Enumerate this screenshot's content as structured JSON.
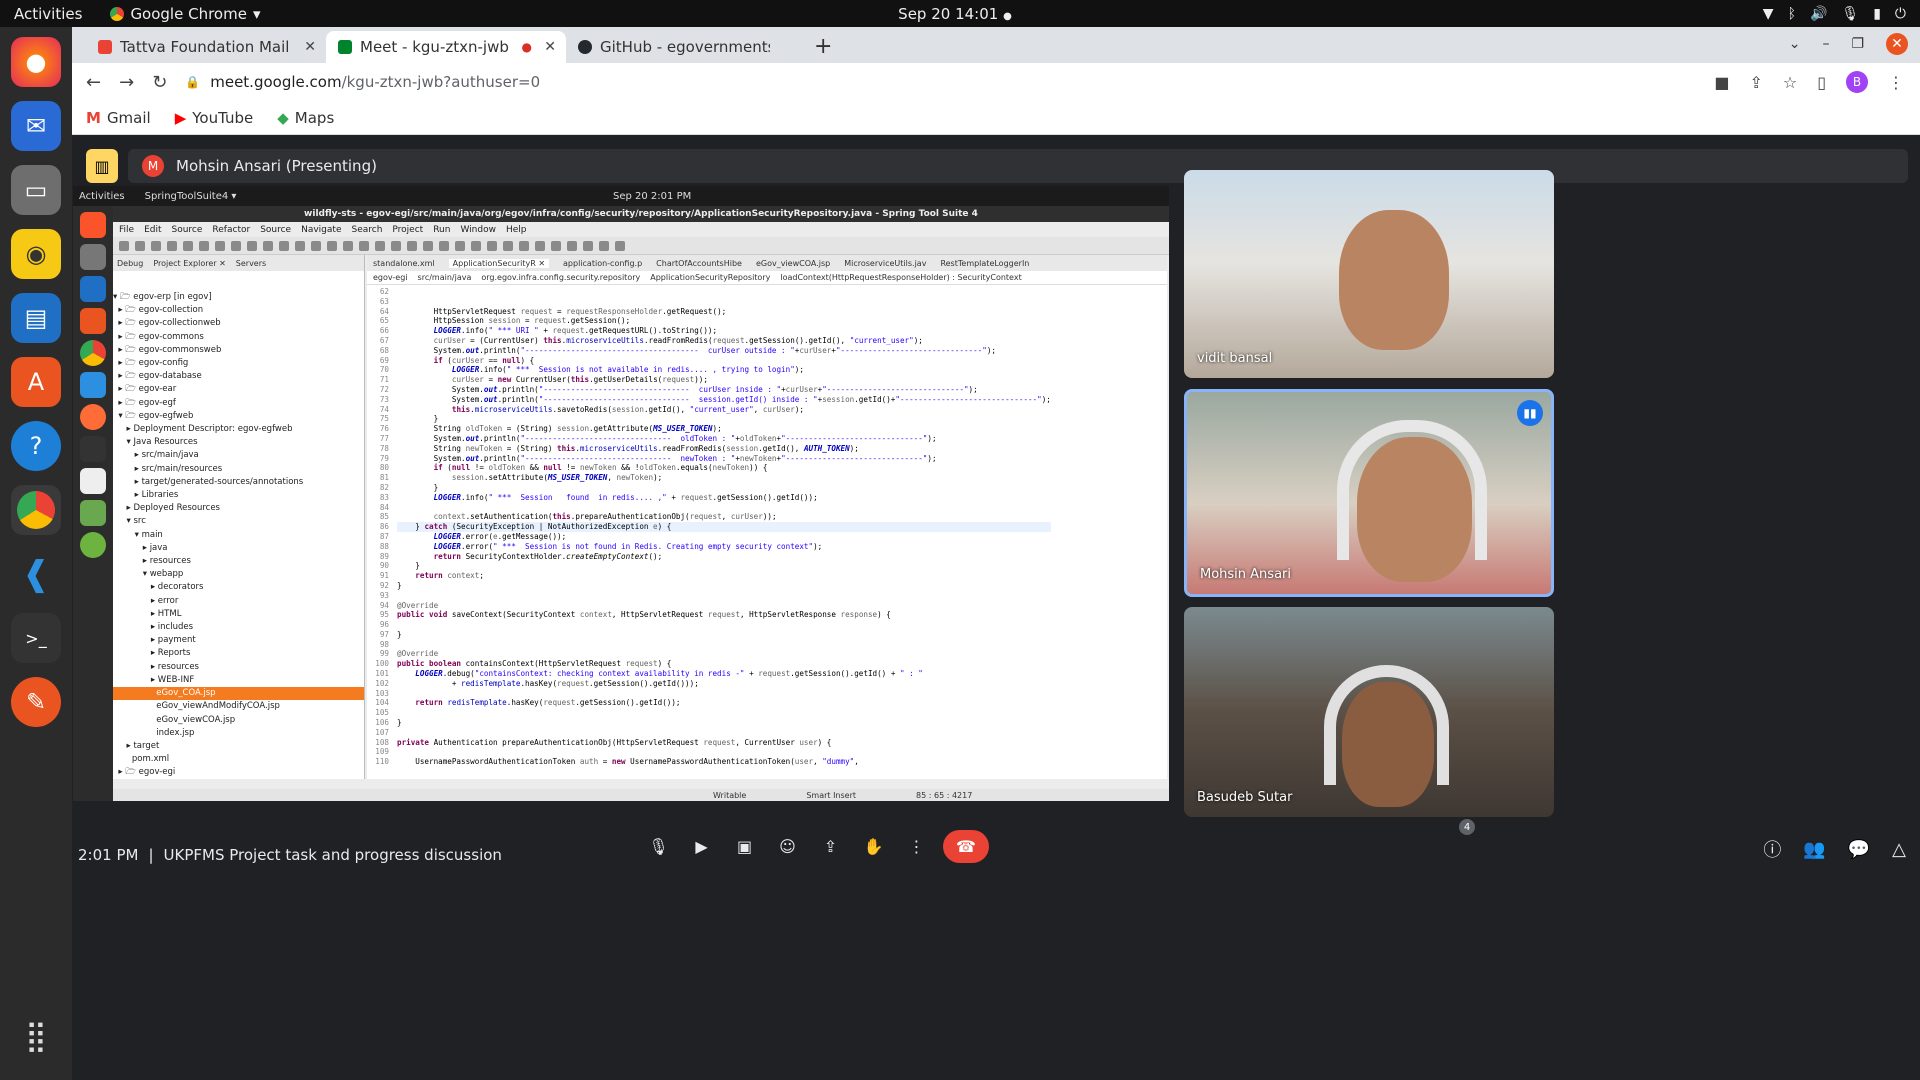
{
  "system": {
    "activities": "Activities",
    "app_name": "Google Chrome",
    "app_menu_arrow": "▾",
    "clock": "Sep 20  14:01",
    "clock_dot": "●"
  },
  "browser": {
    "tabs": [
      {
        "label": "Tattva Foundation Mail",
        "favicon_color": "#ea4335"
      },
      {
        "label": "Meet - kgu-ztxn-jwb",
        "favicon_color": "#00832d"
      },
      {
        "label": "GitHub - egovernments/c",
        "favicon_color": "#24292f"
      }
    ],
    "url_host": "meet.google.com",
    "url_path": "/kgu-ztxn-jwb?authuser=0",
    "profile_initial": "B",
    "bookmarks": [
      "Gmail",
      "YouTube",
      "Maps"
    ]
  },
  "meet": {
    "presenter_initial": "M",
    "presenter_label": "Mohsin Ansari (Presenting)",
    "time": "2:01 PM",
    "separator": "|",
    "meeting_title": "UKPFMS Project task and progress discussion",
    "participant_count": "4",
    "participants": [
      "vidit bansal",
      "Mohsin Ansari",
      "Basudeb Sutar"
    ],
    "speaking_icon": "audio-waves-icon"
  },
  "shared_screen": {
    "activities": "Activities",
    "app_name": "SpringToolSuite4 ▾",
    "clock": "Sep 20  2:01 PM",
    "window_title": "wildfly-sts - egov-egi/src/main/java/org/egov/infra/config/security/repository/ApplicationSecurityRepository.java - Spring Tool Suite 4",
    "menu": [
      "File",
      "Edit",
      "Source",
      "Refactor",
      "Source",
      "Navigate",
      "Search",
      "Project",
      "Run",
      "Window",
      "Help"
    ],
    "explorer_tabs": [
      "Debug",
      "Project Explorer ✕",
      "Servers"
    ],
    "tree": [
      "▾ 🗁 egov-erp [in egov]",
      "  ▸ 🗁 egov-collection",
      "  ▸ 🗁 egov-collectionweb",
      "  ▸ 🗁 egov-commons",
      "  ▸ 🗁 egov-commonsweb",
      "  ▸ 🗁 egov-config",
      "  ▸ 🗁 egov-database",
      "  ▸ 🗁 egov-ear",
      "  ▸ 🗁 egov-egf",
      "  ▾ 🗁 egov-egfweb",
      "     ▸ Deployment Descriptor: egov-egfweb",
      "     ▾ Java Resources",
      "        ▸ src/main/java",
      "        ▸ src/main/resources",
      "        ▸ target/generated-sources/annotations",
      "        ▸ Libraries",
      "     ▸ Deployed Resources",
      "     ▾ src",
      "        ▾ main",
      "           ▸ java",
      "           ▸ resources",
      "           ▾ webapp",
      "              ▸ decorators",
      "              ▸ error",
      "              ▸ HTML",
      "              ▸ includes",
      "              ▸ payment",
      "              ▸ Reports",
      "              ▸ resources",
      "              ▸ WEB-INF",
      "                eGov_COA.jsp",
      "                eGov_viewAndModifyCOA.jsp",
      "                eGov_viewCOA.jsp",
      "                index.jsp",
      "     ▸ target",
      "       pom.xml",
      "  ▸ 🗁 egov-egi"
    ],
    "selected_index": 30,
    "editor_tabs": [
      "standalone.xml",
      "ApplicationSecurityR ✕",
      "application-config.p",
      "ChartOfAccountsHibe",
      "eGov_viewCOA.jsp",
      "MicroserviceUtils.jav",
      "RestTemplateLoggerIn"
    ],
    "breadcrumb": [
      "egov-egi",
      "src/main/java",
      "org.egov.infra.config.security.repository",
      "ApplicationSecurityRepository",
      "loadContext(HttpRequestResponseHolder) : SecurityContext"
    ],
    "line_start": 62,
    "status": [
      "Writable",
      "Smart Insert",
      "85 : 65 : 4217"
    ]
  }
}
